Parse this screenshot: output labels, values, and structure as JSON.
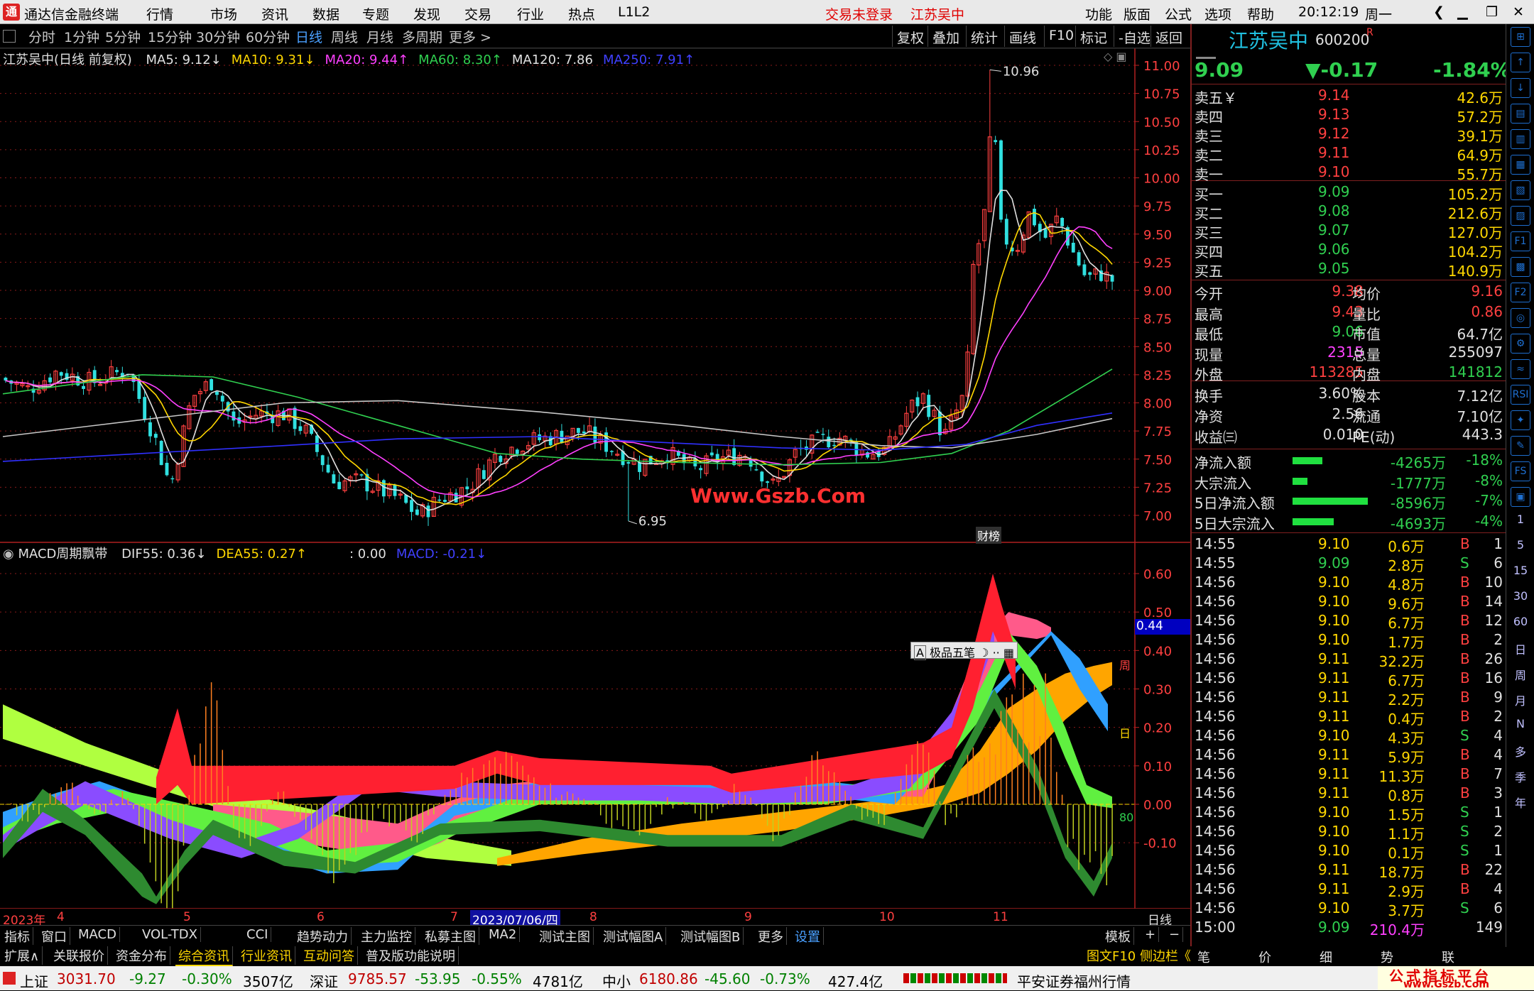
{
  "titlebar": {
    "app": "通达信金融终端",
    "menus": [
      "行情",
      "市场",
      "资讯",
      "数据",
      "专题",
      "发现",
      "交易",
      "行业",
      "热点",
      "L1L2"
    ],
    "login": "交易未登录",
    "stock": "江苏吴中",
    "right": [
      "功能",
      "版面",
      "公式",
      "选项",
      "帮助"
    ],
    "time": "20:12:19",
    "weekday": "周一"
  },
  "periods": [
    "分时",
    "1分钟",
    "5分钟",
    "15分钟",
    "30分钟",
    "60分钟",
    "日线",
    "周线",
    "月线",
    "多周期",
    "更多 >"
  ],
  "tools": [
    "复权",
    "叠加",
    "统计",
    "画线",
    "F10",
    "标记",
    "-自选",
    "返回"
  ],
  "ma_legend": {
    "name": "江苏吴中(日线 前复权)",
    "items": [
      {
        "t": "MA5: 9.12↓",
        "c": "#e0e0e0"
      },
      {
        "t": "MA10: 9.31↓",
        "c": "#ffd700"
      },
      {
        "t": "MA20: 9.44↑",
        "c": "#ff40ff"
      },
      {
        "t": "MA60: 8.30↑",
        "c": "#30d050"
      },
      {
        "t": "MA120: 7.86",
        "c": "#e0e0e0"
      },
      {
        "t": "MA250: 7.91↑",
        "c": "#4040ff"
      }
    ]
  },
  "price_axis": [
    "11.00",
    "10.75",
    "10.50",
    "10.25",
    "10.00",
    "9.75",
    "9.50",
    "9.25",
    "9.00",
    "8.75",
    "8.50",
    "8.25",
    "8.00",
    "7.75",
    "7.50",
    "7.25",
    "7.00"
  ],
  "price_marks": {
    "high": "10.96",
    "low": "6.95"
  },
  "watermark": "Www.Gszb.Com",
  "tag_bang": "财榜",
  "macd_legend": {
    "name": "MACD周期飘带",
    "items": [
      {
        "t": "DIF55: 0.36↓",
        "c": "#e0e0e0"
      },
      {
        "t": "DEA55: 0.27↑",
        "c": "#ffd700"
      },
      {
        "t": ": 0.00",
        "c": "#e0e0e0"
      },
      {
        "t": "MACD: -0.21↓",
        "c": "#4040ff"
      }
    ]
  },
  "macd_axis": [
    "0.60",
    "0.50",
    "0.40",
    "0.30",
    "0.20",
    "0.10",
    "0.00",
    "-0.10"
  ],
  "macd_current": "0.44",
  "macd_tags": {
    "week": "周",
    "day": "日",
    "n80": "80"
  },
  "ime": "极品五笔",
  "dates": {
    "year": "2023年",
    "m4": "4",
    "m5": "5",
    "m6": "6",
    "m7": "7",
    "sel": "2023/07/06/四",
    "m8": "8",
    "m9": "9",
    "m10": "10",
    "m11": "11",
    "period": "日线"
  },
  "quote": {
    "name": "江苏吴中",
    "code": "600200",
    "price": "9.09",
    "change": "▼-0.17",
    "pct": "-1.84%"
  },
  "asks": [
    {
      "l": "卖五￥",
      "p": "9.14",
      "v": "42.6万"
    },
    {
      "l": "卖四",
      "p": "9.13",
      "v": "57.2万"
    },
    {
      "l": "卖三",
      "p": "9.12",
      "v": "39.1万"
    },
    {
      "l": "卖二",
      "p": "9.11",
      "v": "64.9万"
    },
    {
      "l": "卖一",
      "p": "9.10",
      "v": "55.7万"
    }
  ],
  "bids": [
    {
      "l": "买一",
      "p": "9.09",
      "v": "105.2万"
    },
    {
      "l": "买二",
      "p": "9.08",
      "v": "212.6万"
    },
    {
      "l": "买三",
      "p": "9.07",
      "v": "127.0万"
    },
    {
      "l": "买四",
      "p": "9.06",
      "v": "104.2万"
    },
    {
      "l": "买五",
      "p": "9.05",
      "v": "140.9万"
    }
  ],
  "stats": [
    {
      "a": "今开",
      "b": "9.38",
      "bc": "red",
      "c": "均价",
      "d": "9.16",
      "dc": "red"
    },
    {
      "a": "最高",
      "b": "9.43",
      "bc": "red",
      "c": "量比",
      "d": "0.86",
      "dc": "red"
    },
    {
      "a": "最低",
      "b": "9.06",
      "bc": "grn",
      "c": "市值",
      "d": "64.7亿",
      "dc": "wht"
    },
    {
      "a": "现量",
      "b": "2315",
      "bc": "mag",
      "c": "总量",
      "d": "255097",
      "dc": "wht"
    },
    {
      "a": "外盘",
      "b": "113285",
      "bc": "red",
      "c": "内盘",
      "d": "141812",
      "dc": "grn"
    }
  ],
  "stats2": [
    {
      "a": "换手",
      "b": "3.60%",
      "c": "股本",
      "d": "7.12亿"
    },
    {
      "a": "净资",
      "b": "2.56",
      "c": "流通",
      "d": "7.10亿"
    },
    {
      "a": "收益㈢",
      "b": "0.010",
      "c": "PE(动)",
      "d": "443.3"
    }
  ],
  "flows": [
    {
      "l": "净流入额",
      "w": 0.4,
      "v": "-4265万",
      "p": "-18%"
    },
    {
      "l": "大宗流入",
      "w": 0.2,
      "v": "-1777万",
      "p": "-8%"
    },
    {
      "l": "5日净流入额",
      "w": 1.0,
      "v": "-8596万",
      "p": "-7%"
    },
    {
      "l": "5日大宗流入",
      "w": 0.55,
      "v": "-4693万",
      "p": "-4%"
    }
  ],
  "ticks": [
    [
      "14:55",
      "9.10",
      "0.6万",
      "B",
      "1"
    ],
    [
      "14:55",
      "9.09",
      "2.8万",
      "S",
      "6"
    ],
    [
      "14:56",
      "9.10",
      "4.8万",
      "B",
      "10"
    ],
    [
      "14:56",
      "9.10",
      "9.6万",
      "B",
      "14"
    ],
    [
      "14:56",
      "9.10",
      "6.7万",
      "B",
      "12"
    ],
    [
      "14:56",
      "9.10",
      "1.7万",
      "B",
      "2"
    ],
    [
      "14:56",
      "9.11",
      "32.2万",
      "B",
      "26"
    ],
    [
      "14:56",
      "9.11",
      "6.7万",
      "B",
      "16"
    ],
    [
      "14:56",
      "9.11",
      "2.2万",
      "B",
      "9"
    ],
    [
      "14:56",
      "9.11",
      "0.4万",
      "B",
      "2"
    ],
    [
      "14:56",
      "9.10",
      "4.3万",
      "S",
      "4"
    ],
    [
      "14:56",
      "9.11",
      "5.9万",
      "B",
      "4"
    ],
    [
      "14:56",
      "9.11",
      "11.3万",
      "B",
      "7"
    ],
    [
      "14:56",
      "9.11",
      "0.8万",
      "B",
      "3"
    ],
    [
      "14:56",
      "9.10",
      "1.5万",
      "S",
      "1"
    ],
    [
      "14:56",
      "9.10",
      "1.1万",
      "S",
      "2"
    ],
    [
      "14:56",
      "9.10",
      "0.1万",
      "S",
      "1"
    ],
    [
      "14:56",
      "9.11",
      "18.7万",
      "B",
      "22"
    ],
    [
      "14:56",
      "9.11",
      "2.9万",
      "B",
      "4"
    ],
    [
      "14:56",
      "9.10",
      "3.7万",
      "S",
      "6"
    ],
    [
      "15:00",
      "9.09",
      "210.4万",
      "",
      "149"
    ]
  ],
  "tabs1": [
    "指标",
    "窗口",
    "MACD",
    "VOL-TDX",
    "CCI",
    "趋势动力",
    "主力监控",
    "私募主图",
    "MA2",
    "测试主图",
    "测试幅图A",
    "测试幅图B",
    "更多",
    "设置"
  ],
  "tabs1_right": [
    "模板",
    "+",
    "−"
  ],
  "tabs2": [
    "扩展∧",
    "关联报价",
    "资金分布",
    "综合资讯",
    "行业资讯",
    "互动问答",
    "普及版功能说明"
  ],
  "tabs2_right": "图文F10 侧边栏《",
  "rtabs": [
    "笔",
    "价",
    "细",
    "势",
    "联"
  ],
  "side_icons": [
    "⊞",
    "↑",
    "↓",
    "▤",
    "▥",
    "▦",
    "▧",
    "▨",
    "F1",
    "▩",
    "F2",
    "◎",
    "⚙",
    "≈",
    "RSI",
    "✦",
    "✎",
    "FS",
    "▣",
    "1",
    "5",
    "15",
    "30",
    "60",
    "日",
    "周",
    "月",
    "N",
    "多",
    "季",
    "年"
  ],
  "status": {
    "sh": "上证",
    "sh_v": "3031.70",
    "sh_c": "-9.27",
    "sh_p": "-0.30%",
    "sh_a": "3507亿",
    "sz": "深证",
    "sz_v": "9785.57",
    "sz_c": "-53.95",
    "sz_p": "-0.55%",
    "sz_a": "4781亿",
    "zx": "中小",
    "zx_v": "6180.86",
    "zx_c": "-45.60",
    "zx_p": "-0.73%",
    "zx_a": "427.4亿",
    "broker": "平安证券福州行情",
    "brand": "公式指标平台",
    "brand2": "www.Gszb.Com"
  },
  "colors": {
    "up": "#ff4040",
    "down": "#30e0e0",
    "ma5": "#e0e0e0",
    "ma10": "#ffd700",
    "ma20": "#ff40ff",
    "ma60": "#30d050",
    "ma120": "#c8c8c8",
    "ma250": "#3030ff"
  }
}
